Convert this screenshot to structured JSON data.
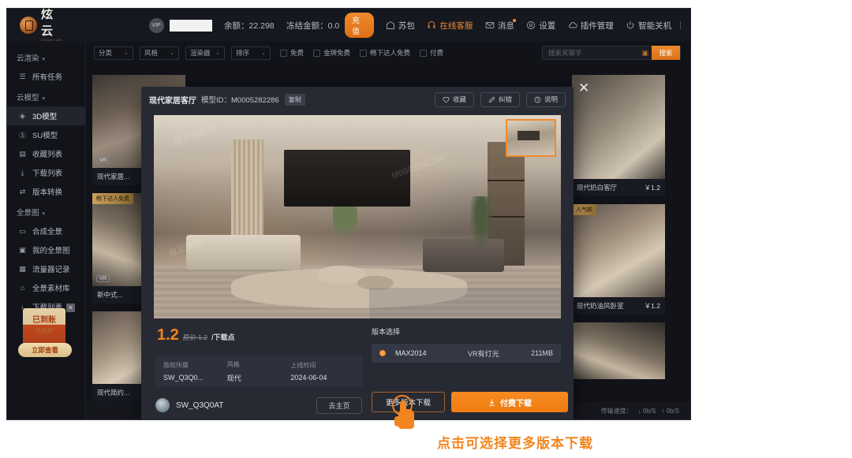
{
  "titlebar": {
    "brand_cn": "炫云",
    "brand_en": "XUANYUN CLOUD",
    "brand_r": "®",
    "avatar_text": "VIP",
    "balance": "余额：22.298",
    "frozen": "冻结金额：0.0",
    "recharge": "充值",
    "wallet": "苏包",
    "support": "在线客服",
    "message": "消息",
    "settings": "设置",
    "plugins": "插件管理",
    "shutdown": "智能关机",
    "minimize": "–",
    "maximize": "▢",
    "close": "✕"
  },
  "sidebar": {
    "groups": [
      {
        "label": "云渲染",
        "items": [
          {
            "label": "所有任务",
            "icon": "list-icon",
            "active": false
          }
        ]
      },
      {
        "label": "云模型",
        "items": [
          {
            "label": "3D模型",
            "icon": "cube-icon",
            "active": true
          },
          {
            "label": "SU模型",
            "icon": "sketchup-icon",
            "active": false
          },
          {
            "label": "收藏列表",
            "icon": "star-box-icon",
            "active": false
          },
          {
            "label": "下载列表",
            "icon": "download-icon",
            "active": false
          },
          {
            "label": "版本转换",
            "icon": "swap-icon",
            "active": false
          }
        ]
      },
      {
        "label": "全景图",
        "items": [
          {
            "label": "合成全景",
            "icon": "panorama-icon",
            "active": false
          },
          {
            "label": "我的全景图",
            "icon": "image-icon",
            "active": false
          },
          {
            "label": "流量器记录",
            "icon": "record-icon",
            "active": false
          },
          {
            "label": "全景素材库",
            "icon": "library-icon",
            "active": false
          },
          {
            "label": "下载列表",
            "icon": "download-icon",
            "active": false
          }
        ]
      }
    ],
    "promo": {
      "title": "已到账",
      "subtitle": "代金券",
      "cta": "立即查看",
      "close": "✕"
    }
  },
  "filters": {
    "selects": [
      {
        "label": "分类",
        "caret": "⌄"
      },
      {
        "label": "风格",
        "caret": "⌄"
      },
      {
        "label": "渲染器",
        "caret": "⌄"
      },
      {
        "label": "排序",
        "caret": "⌄"
      }
    ],
    "checkboxes": [
      {
        "label": "免费",
        "checked": false
      },
      {
        "label": "金牌免费",
        "checked": false
      },
      {
        "label": "畅下达人免费",
        "checked": false
      },
      {
        "label": "付费",
        "checked": false
      }
    ],
    "search": {
      "placeholder": "搜索关键字",
      "value": "",
      "camera_icon": "camera-icon",
      "button": "搜索"
    }
  },
  "grid": {
    "cards": [
      {
        "name": "现代家居...",
        "price": "",
        "badge": "",
        "tag": "VR",
        "tone": "room-a"
      },
      {
        "name": "新中式...",
        "price": "",
        "badge": "畅下达人免费",
        "tag": "VR",
        "tone": "room-c"
      },
      {
        "name": "现代简约...",
        "price": "",
        "badge": "",
        "tag": "",
        "tone": "room-b"
      },
      {
        "name": "现代奶白客厅",
        "price": "￥1.2",
        "badge": "",
        "tag": "",
        "tone": "room-e"
      },
      {
        "name": "现代奶油风卧室",
        "price": "￥1.2",
        "badge": "人气款",
        "tag": "",
        "tone": "room-b"
      },
      {
        "name": "",
        "price": "",
        "badge": "",
        "tag": "",
        "tone": "room-c"
      }
    ]
  },
  "statusbar": {
    "label": "传输速度：",
    "down": "↓ 0b/S",
    "up": "↑ 0b/S"
  },
  "modal": {
    "close_icon": "close-icon",
    "title": "现代家居客厅",
    "model_id": "模型ID：M0005282286",
    "copy": "复制",
    "actions": [
      {
        "label": "收藏",
        "icon": "heart-icon"
      },
      {
        "label": "纠错",
        "icon": "pencil-icon"
      },
      {
        "label": "说明",
        "icon": "question-icon"
      }
    ],
    "watermarks": [
      "炫云模型库",
      "M0005282286",
      "炫云模型"
    ],
    "price": {
      "value": "1.2",
      "original": "原价 1.2",
      "unit": "/下载点"
    },
    "info": [
      {
        "key": "版权所属",
        "value": "SW_Q3Q0..."
      },
      {
        "key": "风格",
        "value": "现代"
      },
      {
        "key": "上线时间",
        "value": "2024-06-04"
      }
    ],
    "author": {
      "name": "SW_Q3Q0AT",
      "home_button": "去主页"
    },
    "versions": {
      "title": "版本选择",
      "rows": [
        {
          "name": "MAX2014",
          "light": "VR有灯光",
          "size": "211MB",
          "selected": true
        }
      ]
    },
    "download": {
      "more": "更多版本下载",
      "primary": "付费下载",
      "primary_icon": "download-icon"
    }
  },
  "annotation": {
    "text": "点击可选择更多版本下载",
    "cursor_icon": "click-hand-icon"
  }
}
